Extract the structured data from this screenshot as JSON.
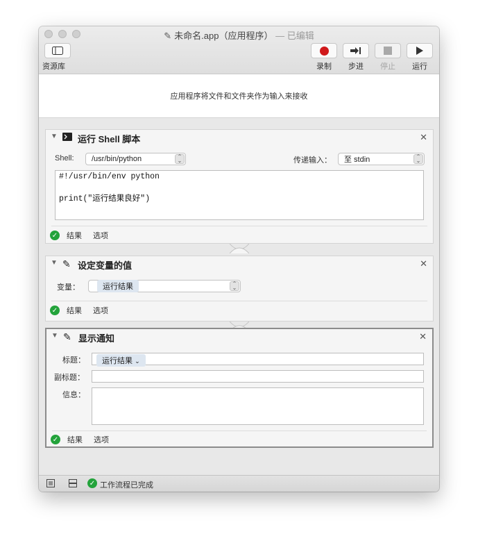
{
  "window": {
    "title_icon": "script-icon",
    "title": "未命名.app（应用程序）",
    "title_suffix": "— 已编辑"
  },
  "toolbar": {
    "library_label": "资源库",
    "record_label": "录制",
    "step_label": "步进",
    "stop_label": "停止",
    "run_label": "运行"
  },
  "dropzone": {
    "text": "应用程序将文件和文件夹作为输入来接收"
  },
  "actions": [
    {
      "title": "运行 Shell 脚本",
      "shell_label": "Shell:",
      "shell_value": "/usr/bin/python",
      "input_label": "传递输入：",
      "input_value": "至 stdin",
      "script_lines": [
        "#!/usr/bin/env python",
        "",
        "print(\"运行结果良好\")"
      ],
      "results_label": "结果",
      "options_label": "选项"
    },
    {
      "title": "设定变量的值",
      "variable_label": "变量：",
      "variable_value": "运行结果",
      "results_label": "结果",
      "options_label": "选项"
    },
    {
      "title": "显示通知",
      "title_label": "标题：",
      "title_value": "运行结果",
      "subtitle_label": "副标题：",
      "info_label": "信息：",
      "results_label": "结果",
      "options_label": "选项"
    }
  ],
  "statusbar": {
    "text": "工作流程已完成"
  },
  "colors": {
    "record": "#d0191b",
    "success": "#23a33b",
    "token_bg": "#dde6f0"
  }
}
